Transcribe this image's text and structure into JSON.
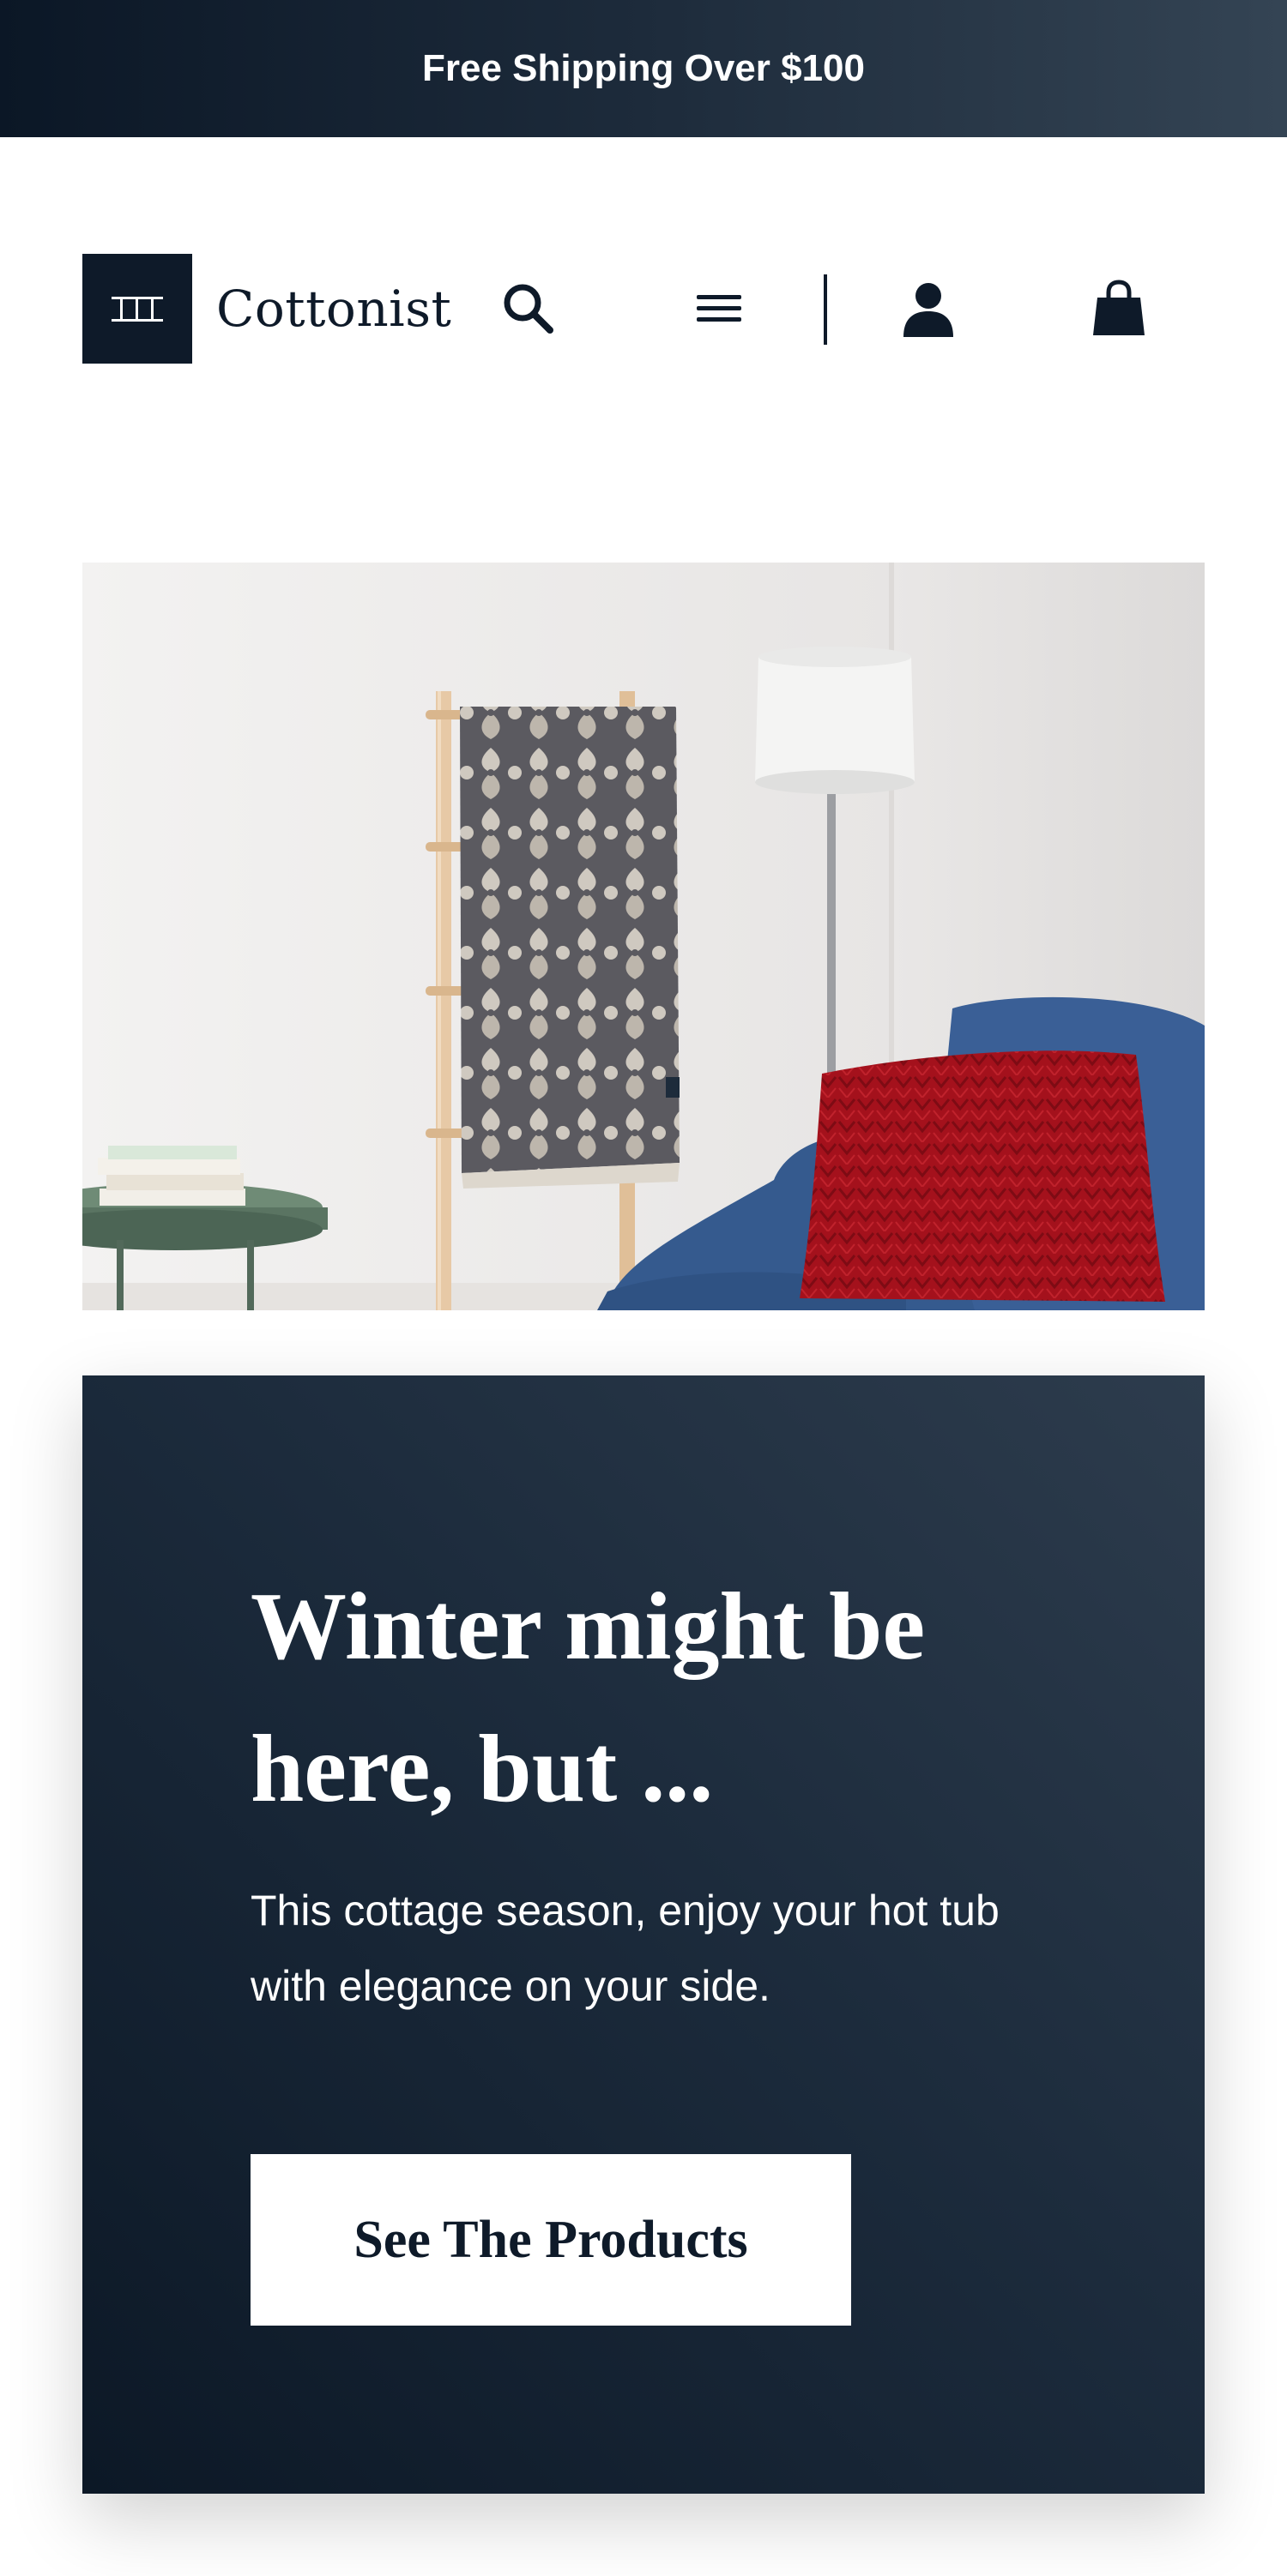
{
  "announcement": {
    "text": "Free Shipping Over $100"
  },
  "header": {
    "brand_name": "Cottonist",
    "icons": {
      "search": "search-icon",
      "menu": "hamburger-menu-icon",
      "account": "user-icon",
      "cart": "shopping-bag-icon"
    }
  },
  "hero": {
    "image_description": "decorative throw blanket on a wooden ladder beside a lamp, blue sofa with red knit pillow, green side table with books"
  },
  "promo": {
    "title": "Winter might be here, but ...",
    "body": "This cottage season, enjoy your hot tub with elegance on your side.",
    "cta_label": "See The Products"
  },
  "colors": {
    "navy": "#0e1a29",
    "white": "#ffffff",
    "sofa_blue": "#3a5f96",
    "pillow_red": "#a4111c"
  }
}
